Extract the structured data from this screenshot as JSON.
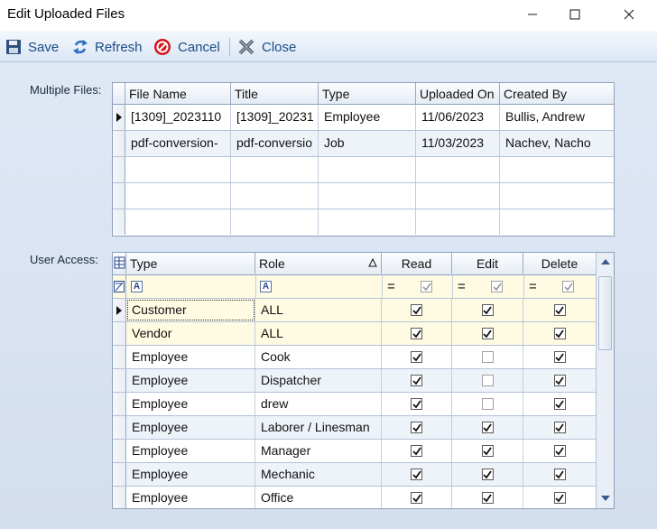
{
  "window": {
    "title": "Edit Uploaded Files"
  },
  "toolbar": {
    "save": "Save",
    "refresh": "Refresh",
    "cancel": "Cancel",
    "close": "Close"
  },
  "labels": {
    "multiple_files": "Multiple Files:",
    "user_access": "User Access:"
  },
  "files": {
    "columns": [
      "File Name",
      "Title",
      "Type",
      "Uploaded On",
      "Created By"
    ],
    "rows": [
      [
        "[1309]_2023110",
        "[1309]_20231",
        "Employee",
        "11/06/2023",
        "Bullis, Andrew"
      ],
      [
        "pdf-conversion-",
        "pdf-conversio",
        "Job",
        "11/03/2023",
        "Nachev, Nacho"
      ]
    ]
  },
  "access": {
    "columns": [
      "Type",
      "Role",
      "Read",
      "Edit",
      "Delete"
    ],
    "filter_equals": "=",
    "filter_text_icon": "A",
    "rows": [
      {
        "type": "Customer",
        "role": "ALL",
        "read": true,
        "edit": true,
        "delete": true
      },
      {
        "type": "Vendor",
        "role": "ALL",
        "read": true,
        "edit": true,
        "delete": true
      },
      {
        "type": "Employee",
        "role": "Cook",
        "read": true,
        "edit": false,
        "delete": true
      },
      {
        "type": "Employee",
        "role": "Dispatcher",
        "read": true,
        "edit": false,
        "delete": true
      },
      {
        "type": "Employee",
        "role": "drew",
        "read": true,
        "edit": false,
        "delete": true
      },
      {
        "type": "Employee",
        "role": "Laborer / Linesman",
        "read": true,
        "edit": true,
        "delete": true
      },
      {
        "type": "Employee",
        "role": "Manager",
        "read": true,
        "edit": true,
        "delete": true
      },
      {
        "type": "Employee",
        "role": "Mechanic",
        "read": true,
        "edit": true,
        "delete": true
      },
      {
        "type": "Employee",
        "role": "Office",
        "read": true,
        "edit": true,
        "delete": true
      }
    ]
  },
  "icons": {
    "save": "floppy-disk-icon",
    "refresh": "refresh-icon",
    "cancel": "cancel-icon",
    "close": "close-x-icon"
  },
  "colors": {
    "toolbar_text": "#1a4d86",
    "selected_row": "#fffbe3",
    "alt_row": "#eef3fa"
  }
}
